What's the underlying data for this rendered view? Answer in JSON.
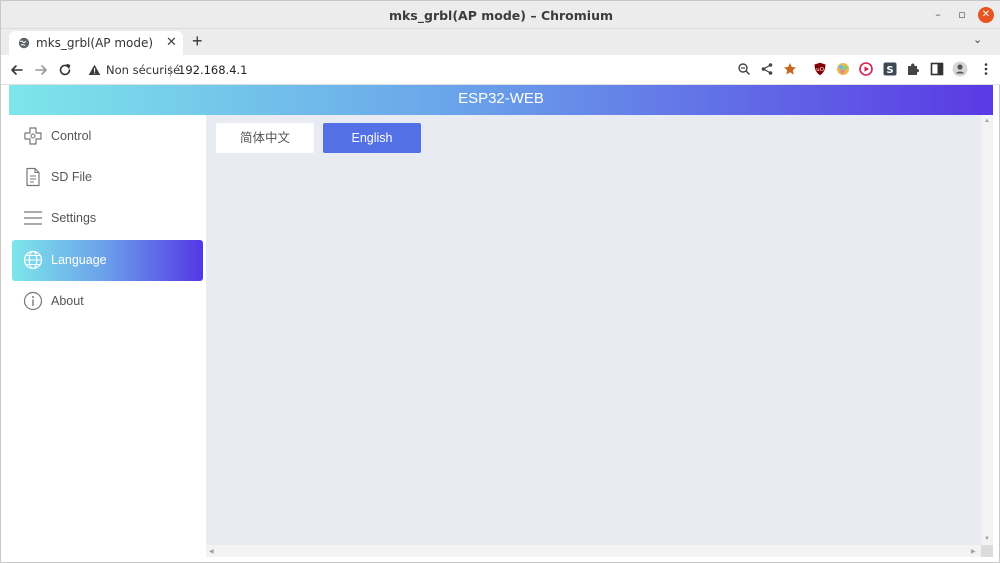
{
  "window": {
    "title": "mks_grbl(AP mode) – Chromium",
    "minimize_glyph": "–",
    "maximize_glyph": "▫",
    "close_glyph": "✕"
  },
  "tabs": [
    {
      "title": "mks_grbl(AP mode)",
      "icon": "globe-icon",
      "close_glyph": "✕"
    }
  ],
  "tabstrip": {
    "new_tab_glyph": "+",
    "tab_list_glyph": "⌄"
  },
  "toolbar": {
    "security_text": "Non sécurisé",
    "separator": "|",
    "url": "192.168.4.1",
    "icons": [
      "back-icon",
      "forward-icon",
      "reload-icon",
      "zoom-icon",
      "share-icon",
      "bookmark-star-icon",
      "ublock-icon",
      "color-wheel-icon",
      "play-icon",
      "s-extension-icon",
      "extensions-puzzle-icon",
      "side-panel-icon",
      "profile-icon",
      "menu-icon"
    ]
  },
  "app": {
    "header_title": "ESP32-WEB",
    "sidebar": [
      {
        "label": "Control",
        "icon": "gamepad-icon",
        "active": false
      },
      {
        "label": "SD File",
        "icon": "file-icon",
        "active": false
      },
      {
        "label": "Settings",
        "icon": "menu-lines-icon",
        "active": false
      },
      {
        "label": "Language",
        "icon": "globe-icon",
        "active": true
      },
      {
        "label": "About",
        "icon": "info-icon",
        "active": false
      }
    ],
    "language_buttons": [
      {
        "label": "简体中文",
        "selected": false
      },
      {
        "label": "English",
        "selected": true
      }
    ]
  },
  "colors": {
    "accent": "#5470e6",
    "gradient_start": "#7de6ea",
    "gradient_end": "#5437e6",
    "content_bg": "#e8ebf2",
    "close_button": "#e95420"
  }
}
